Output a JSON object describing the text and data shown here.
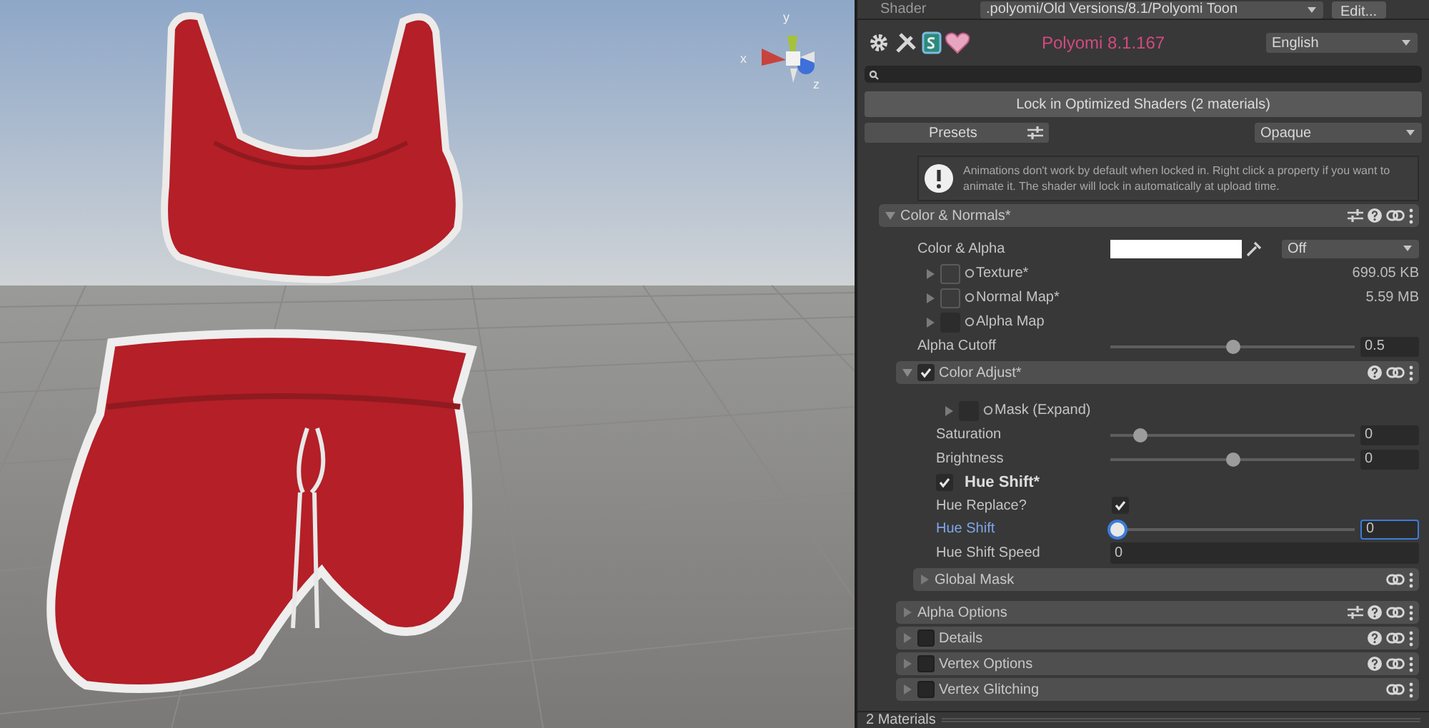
{
  "viewport": {
    "gizmo_labels": {
      "y": "y",
      "x": "x",
      "z": "z"
    }
  },
  "shader_bar": {
    "label": "Shader",
    "value": ".polyomi/Old Versions/8.1/Polyomi Toon",
    "button": "Edit..."
  },
  "header": {
    "title": "Polyomi 8.1.167",
    "language": "English"
  },
  "lock_button": "Lock in Optimized Shaders (2 materials)",
  "presets": {
    "label": "Presets",
    "render_mode": "Opaque"
  },
  "help_text": "Animations don't work by default when locked in. Right click a property if you want to animate it. The shader will lock in automatically at upload time.",
  "sections": [
    {
      "kind": "section",
      "label": "Color & Normals*",
      "expanded": true,
      "presets_button": true,
      "help_button": true,
      "children": [
        {
          "kind": "color",
          "label": "Color & Alpha",
          "dropdown": "Off"
        },
        {
          "kind": "texture",
          "label": "Texture*",
          "size": "699.05 KB",
          "assigned": true
        },
        {
          "kind": "texture",
          "label": "Normal Map*",
          "size": "5.59 MB",
          "assigned": true
        },
        {
          "kind": "texture",
          "label": "Alpha Map",
          "assigned": false
        },
        {
          "kind": "slider",
          "label": "Alpha Cutoff",
          "level": 0.5,
          "value": "0.5"
        },
        {
          "kind": "section",
          "label": "Color Adjust*",
          "enabled": true,
          "expanded": true,
          "presets_button": false,
          "help_button": true,
          "children": [
            {
              "kind": "texture",
              "label": "Mask (Expand)",
              "assigned": false
            },
            {
              "kind": "slider",
              "label": "Saturation",
              "level": 0.1,
              "value": "0"
            },
            {
              "kind": "slider",
              "label": "Brightness",
              "level": 0.5,
              "value": "0"
            },
            {
              "kind": "toggle",
              "label": "Hue Shift*",
              "checked": true
            },
            {
              "kind": "checkbox",
              "label": "Hue Replace?",
              "checked": true
            },
            {
              "kind": "slider",
              "label": "Hue Shift",
              "level": 0,
              "value": "0",
              "focused": true
            },
            {
              "kind": "number",
              "label": "Hue Shift Speed",
              "value": "0"
            },
            {
              "kind": "section",
              "label": "Global Mask",
              "expanded": false,
              "presets_button": false,
              "help_button": false
            }
          ]
        },
        {
          "kind": "section",
          "label": "Alpha Options",
          "expanded": false,
          "presets_button": true,
          "help_button": true
        },
        {
          "kind": "section",
          "label": "Details",
          "enabled": false,
          "expanded": false,
          "presets_button": false,
          "help_button": true
        },
        {
          "kind": "section",
          "label": "Vertex Options",
          "enabled": false,
          "expanded": false,
          "presets_button": false,
          "help_button": true
        },
        {
          "kind": "section",
          "label": "Vertex Glitching",
          "enabled": false,
          "expanded": false,
          "presets_button": false,
          "help_button": false
        }
      ]
    }
  ],
  "footer": "2 Materials"
}
